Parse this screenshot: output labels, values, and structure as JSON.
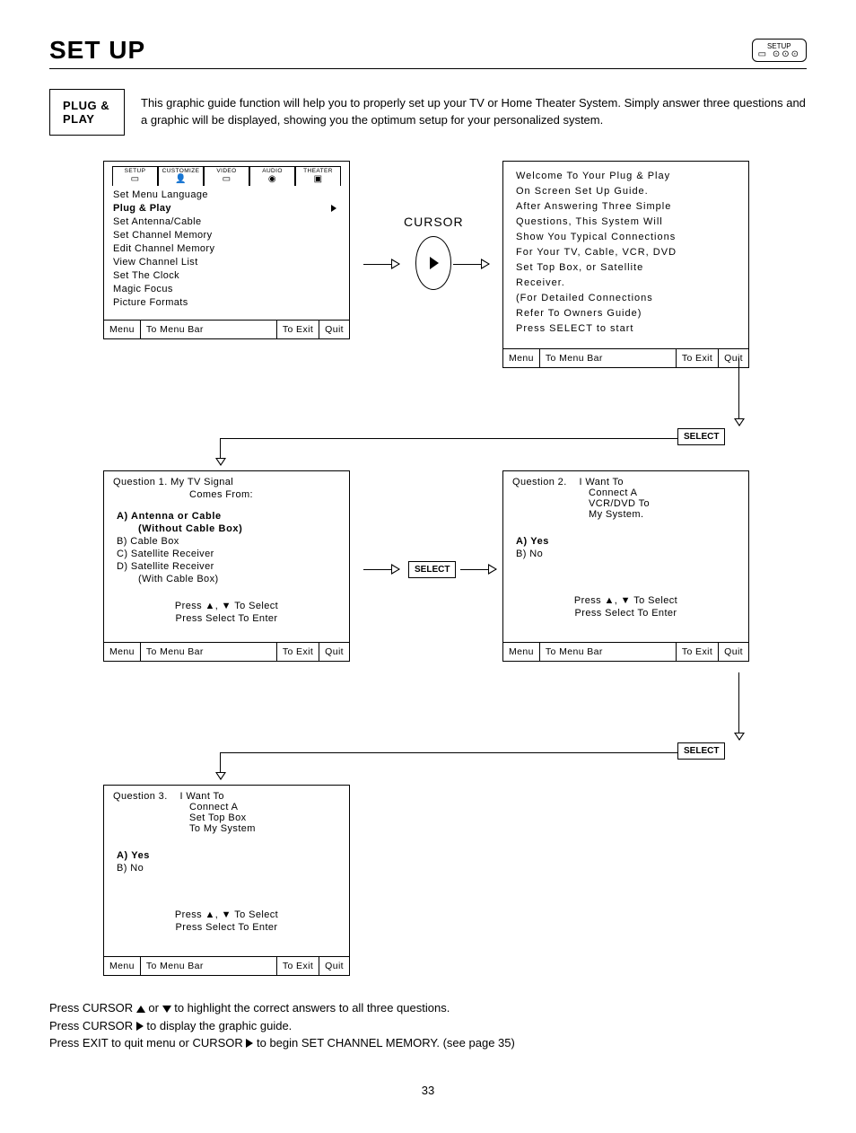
{
  "page": {
    "title": "SET UP",
    "setup_icon_label": "SETUP",
    "number": "33"
  },
  "intro": {
    "badge": "PLUG & PLAY",
    "text": "This graphic guide function will help you to properly set up your TV or Home Theater System.  Simply answer three questions and a graphic will be displayed, showing you the optimum setup for your personalized system."
  },
  "cursor_label": "CURSOR",
  "select_label": "SELECT",
  "tabs": [
    "SETUP",
    "CUSTOMIZE",
    "VIDEO",
    "AUDIO",
    "THEATER"
  ],
  "panel1": {
    "items": [
      "Set Menu Language",
      "Plug & Play",
      "Set Antenna/Cable",
      "Set Channel Memory",
      "Edit Channel Memory",
      "View Channel List",
      "Set The Clock",
      "Magic Focus",
      "Picture Formats"
    ],
    "selected_index": 1
  },
  "panel2": {
    "lines": [
      "Welcome To Your Plug & Play",
      "On Screen Set Up Guide.",
      "After Answering Three Simple",
      "Questions, This System Will",
      "Show You Typical Connections",
      "For Your TV, Cable, VCR, DVD",
      "Set Top Box, or Satellite",
      "Receiver.",
      "(For Detailed Connections",
      "Refer To Owners Guide)",
      "Press SELECT to start"
    ]
  },
  "q1": {
    "title": "Question 1.   My TV Signal",
    "sub": "Comes From:",
    "optA": "A) Antenna or Cable",
    "optA_sub": "(Without Cable Box)",
    "optB": "B) Cable Box",
    "optC": "C) Satellite Receiver",
    "optD": "D) Satellite Receiver",
    "optD_sub": "(With Cable Box)"
  },
  "q2": {
    "title": "Question 2.",
    "sub1": "I Want To",
    "sub2": "Connect A",
    "sub3": "VCR/DVD To",
    "sub4": "My System.",
    "optA": "A) Yes",
    "optB": "B) No"
  },
  "q3": {
    "title": "Question 3.",
    "sub1": "I Want To",
    "sub2": "Connect A",
    "sub3": "Set Top Box",
    "sub4": "To My System",
    "optA": "A) Yes",
    "optB": "B) No"
  },
  "hints": {
    "line1": "Press ▲, ▼ To Select",
    "line2": "Press Select To Enter"
  },
  "footer_cells": {
    "menu": "Menu",
    "to_menu_bar": "To Menu Bar",
    "to_exit": "To Exit",
    "quit": "Quit"
  },
  "notes": {
    "n1a": "Press  CURSOR ",
    "n1b": " or ",
    "n1c": " to highlight the correct answers to all three questions.",
    "n2a": "Press CURSOR ",
    "n2b": " to display the graphic guide.",
    "n3a": "Press EXIT to quit menu or CURSOR ",
    "n3b": " to begin SET CHANNEL MEMORY. (see page 35)"
  }
}
